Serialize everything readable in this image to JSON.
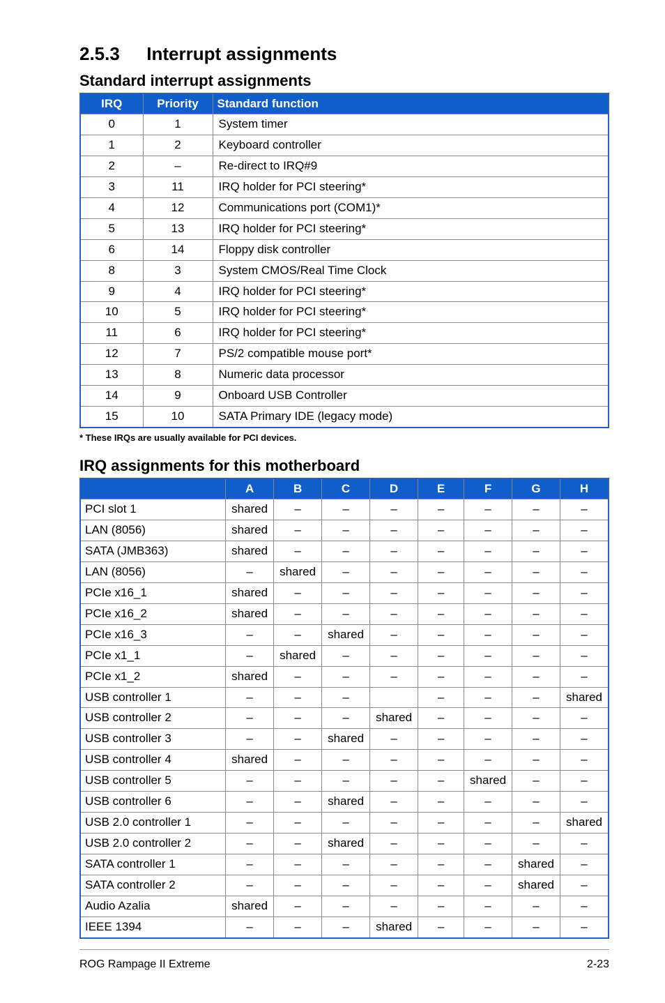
{
  "section": {
    "num": "2.5.3",
    "title": "Interrupt assignments"
  },
  "table1": {
    "heading": "Standard interrupt assignments",
    "headers": [
      "IRQ",
      "Priority",
      "Standard function"
    ],
    "rows": [
      [
        "0",
        "1",
        "System timer"
      ],
      [
        "1",
        "2",
        "Keyboard controller"
      ],
      [
        "2",
        "–",
        "Re-direct to IRQ#9"
      ],
      [
        "3",
        "11",
        "IRQ holder for PCI steering*"
      ],
      [
        "4",
        "12",
        "Communications port (COM1)*"
      ],
      [
        "5",
        "13",
        "IRQ holder for PCI steering*"
      ],
      [
        "6",
        "14",
        "Floppy disk controller"
      ],
      [
        "8",
        "3",
        "System CMOS/Real Time Clock"
      ],
      [
        "9",
        "4",
        "IRQ holder for PCI steering*"
      ],
      [
        "10",
        "5",
        "IRQ holder for PCI steering*"
      ],
      [
        "11",
        "6",
        "IRQ holder for PCI steering*"
      ],
      [
        "12",
        "7",
        "PS/2 compatible mouse port*"
      ],
      [
        "13",
        "8",
        "Numeric data processor"
      ],
      [
        "14",
        "9",
        "Onboard USB Controller"
      ],
      [
        "15",
        "10",
        "SATA Primary IDE (legacy mode)"
      ]
    ],
    "footnote": "* These IRQs are usually available for PCI devices."
  },
  "table2": {
    "heading": "IRQ assignments for this motherboard",
    "headers": [
      "",
      "A",
      "B",
      "C",
      "D",
      "E",
      "F",
      "G",
      "H"
    ],
    "rows": [
      [
        "PCI slot 1",
        "shared",
        "–",
        "–",
        "–",
        "–",
        "–",
        "–",
        "–"
      ],
      [
        "LAN (8056)",
        "shared",
        "–",
        "–",
        "–",
        "–",
        "–",
        "–",
        "–"
      ],
      [
        "SATA (JMB363)",
        "shared",
        "–",
        "–",
        "–",
        "–",
        "–",
        "–",
        "–"
      ],
      [
        "LAN (8056)",
        "–",
        "shared",
        "–",
        "–",
        "–",
        "–",
        "–",
        "–"
      ],
      [
        "PCIe x16_1",
        "shared",
        "–",
        "–",
        "–",
        "–",
        "–",
        "–",
        "–"
      ],
      [
        "PCIe x16_2",
        "shared",
        "–",
        "–",
        "–",
        "–",
        "–",
        "–",
        "–"
      ],
      [
        "PCIe x16_3",
        "–",
        "–",
        "shared",
        "–",
        "–",
        "–",
        "–",
        "–"
      ],
      [
        "PCIe x1_1",
        "–",
        "shared",
        "–",
        "–",
        "–",
        "–",
        "–",
        "–"
      ],
      [
        "PCIe x1_2",
        "shared",
        "–",
        "–",
        "–",
        "–",
        "–",
        "–",
        "–"
      ],
      [
        "USB controller 1",
        "–",
        "–",
        "–",
        "",
        "–",
        "–",
        "–",
        "shared"
      ],
      [
        "USB controller 2",
        "–",
        "–",
        "–",
        "shared",
        "–",
        "–",
        "–",
        "–"
      ],
      [
        "USB controller 3",
        "–",
        "–",
        "shared",
        "–",
        "–",
        "–",
        "–",
        "–"
      ],
      [
        "USB controller 4",
        "shared",
        "–",
        "–",
        "–",
        "–",
        "–",
        "–",
        "–"
      ],
      [
        "USB controller 5",
        "–",
        "–",
        "–",
        "–",
        "–",
        "shared",
        "–",
        "–"
      ],
      [
        "USB controller 6",
        "–",
        "–",
        "shared",
        "–",
        "–",
        "–",
        "–",
        "–"
      ],
      [
        "USB 2.0 controller 1",
        "–",
        "–",
        "–",
        "–",
        "–",
        "–",
        "–",
        "shared"
      ],
      [
        "USB 2.0 controller 2",
        "–",
        "–",
        "shared",
        "–",
        "–",
        "–",
        "–",
        "–"
      ],
      [
        "SATA controller 1",
        "–",
        "–",
        "–",
        "–",
        "–",
        "–",
        "shared",
        "–"
      ],
      [
        "SATA controller 2",
        "–",
        "–",
        "–",
        "–",
        "–",
        "–",
        "shared",
        "–"
      ],
      [
        "Audio Azalia",
        "shared",
        "–",
        "–",
        "–",
        "–",
        "–",
        "–",
        "–"
      ],
      [
        "IEEE 1394",
        "–",
        "–",
        "–",
        "shared",
        "–",
        "–",
        "–",
        "–"
      ]
    ]
  },
  "footer": {
    "left": "ROG Rampage II Extreme",
    "right": "2-23"
  }
}
